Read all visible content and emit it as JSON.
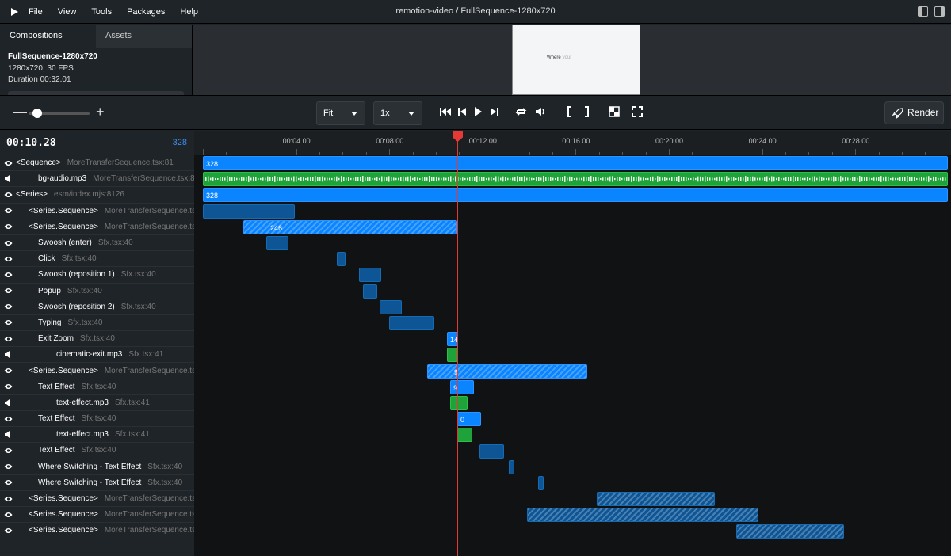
{
  "menu": {
    "items": [
      "File",
      "View",
      "Tools",
      "Packages",
      "Help"
    ],
    "title": "remotion-video / FullSequence-1280x720"
  },
  "sidebar": {
    "tabs": [
      "Compositions",
      "Assets"
    ],
    "composition": {
      "name": "FullSequence-1280x720",
      "resolution": "1280x720, 30 FPS",
      "duration": "Duration 00:32.01"
    }
  },
  "preview": {
    "word1": "Where",
    "word2": "your"
  },
  "controls": {
    "zoom_minus": "—",
    "zoom_plus": "+",
    "zoom_level": 0.07,
    "fit_label": "Fit",
    "speed_label": "1x",
    "render_label": "Render"
  },
  "timeline": {
    "timecode": "00:10.28",
    "frame": "328",
    "ruler_labels": [
      "00:04.00",
      "00:08.00",
      "00:12.00",
      "00:16.00",
      "00:20.00",
      "00:24.00",
      "00:28.00"
    ],
    "layers": [
      {
        "icon": "eye",
        "name": "<Sequence>",
        "src": "MoreTransferSequence.tsx:81",
        "indent": 0
      },
      {
        "icon": "speaker",
        "name": "bg-audio.mp3",
        "src": "MoreTransferSequence.tsx:82",
        "indent": 2
      },
      {
        "icon": "eye",
        "name": "<Series>",
        "src": "esm/index.mjs:8126",
        "indent": 0
      },
      {
        "icon": "eye",
        "name": "<Series.Sequence>",
        "src": "MoreTransferSequence.tsx:",
        "indent": 1
      },
      {
        "icon": "eye",
        "name": "<Series.Sequence>",
        "src": "MoreTransferSequence.tsx:",
        "indent": 1
      },
      {
        "icon": "eye",
        "name": "Swoosh (enter)",
        "src": "Sfx.tsx:40",
        "indent": 2
      },
      {
        "icon": "eye",
        "name": "Click",
        "src": "Sfx.tsx:40",
        "indent": 2
      },
      {
        "icon": "eye",
        "name": "Swoosh (reposition 1)",
        "src": "Sfx.tsx:40",
        "indent": 2
      },
      {
        "icon": "eye",
        "name": "Popup",
        "src": "Sfx.tsx:40",
        "indent": 2
      },
      {
        "icon": "eye",
        "name": "Swoosh (reposition 2)",
        "src": "Sfx.tsx:40",
        "indent": 2
      },
      {
        "icon": "eye",
        "name": "Typing",
        "src": "Sfx.tsx:40",
        "indent": 2
      },
      {
        "icon": "eye",
        "name": "Exit Zoom",
        "src": "Sfx.tsx:40",
        "indent": 2
      },
      {
        "icon": "speaker",
        "name": "cinematic-exit.mp3",
        "src": "Sfx.tsx:41",
        "indent": 3
      },
      {
        "icon": "eye",
        "name": "<Series.Sequence>",
        "src": "MoreTransferSequence.tsx:",
        "indent": 1
      },
      {
        "icon": "eye",
        "name": "Text Effect",
        "src": "Sfx.tsx:40",
        "indent": 2
      },
      {
        "icon": "speaker",
        "name": "text-effect.mp3",
        "src": "Sfx.tsx:41",
        "indent": 3
      },
      {
        "icon": "eye",
        "name": "Text Effect",
        "src": "Sfx.tsx:40",
        "indent": 2
      },
      {
        "icon": "speaker",
        "name": "text-effect.mp3",
        "src": "Sfx.tsx:41",
        "indent": 3
      },
      {
        "icon": "eye",
        "name": "Text Effect",
        "src": "Sfx.tsx:40",
        "indent": 2
      },
      {
        "icon": "eye",
        "name": "Where Switching - Text Effect",
        "src": "Sfx.tsx:40",
        "indent": 2
      },
      {
        "icon": "eye",
        "name": "Where Switching - Text Effect",
        "src": "Sfx.tsx:40",
        "indent": 2
      },
      {
        "icon": "eye",
        "name": "<Series.Sequence>",
        "src": "MoreTransferSequence.tsx:",
        "indent": 1
      },
      {
        "icon": "eye",
        "name": "<Series.Sequence>",
        "src": "MoreTransferSequence.tsx:",
        "indent": 1
      },
      {
        "icon": "eye",
        "name": "<Series.Sequence>",
        "src": "MoreTransferSequence.tsx:",
        "indent": 1
      }
    ],
    "bar_labels": [
      "328",
      "",
      "328",
      "",
      "246",
      "",
      "",
      "",
      "",
      "",
      "",
      "14",
      "",
      "9",
      "9",
      "",
      "0",
      "",
      "",
      "",
      "",
      "",
      "",
      ""
    ]
  },
  "colors": {
    "accent": "#0a84ff",
    "sequence_dark": "#0e5595",
    "audio": "#1fa23a",
    "playhead": "#e53935"
  }
}
